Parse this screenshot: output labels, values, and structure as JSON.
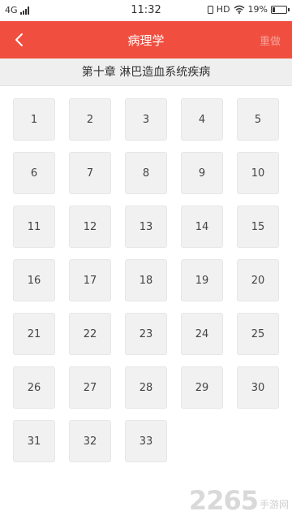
{
  "status_bar": {
    "network": "4G",
    "time": "11:32",
    "hd": "HD",
    "battery_percent": "19%",
    "battery_level": 0.19
  },
  "nav": {
    "title": "病理学",
    "redo_label": "重做",
    "back_icon": "chevron-left-icon",
    "color": "#f04e3f"
  },
  "chapter": {
    "title": "第十章  淋巴造血系统疾病"
  },
  "questions": [
    "1",
    "2",
    "3",
    "4",
    "5",
    "6",
    "7",
    "8",
    "9",
    "10",
    "11",
    "12",
    "13",
    "14",
    "15",
    "16",
    "17",
    "18",
    "19",
    "20",
    "21",
    "22",
    "23",
    "24",
    "25",
    "26",
    "27",
    "28",
    "29",
    "30",
    "31",
    "32",
    "33"
  ],
  "watermark": {
    "number": "2265",
    "suffix": ".com",
    "label": "手游网"
  }
}
